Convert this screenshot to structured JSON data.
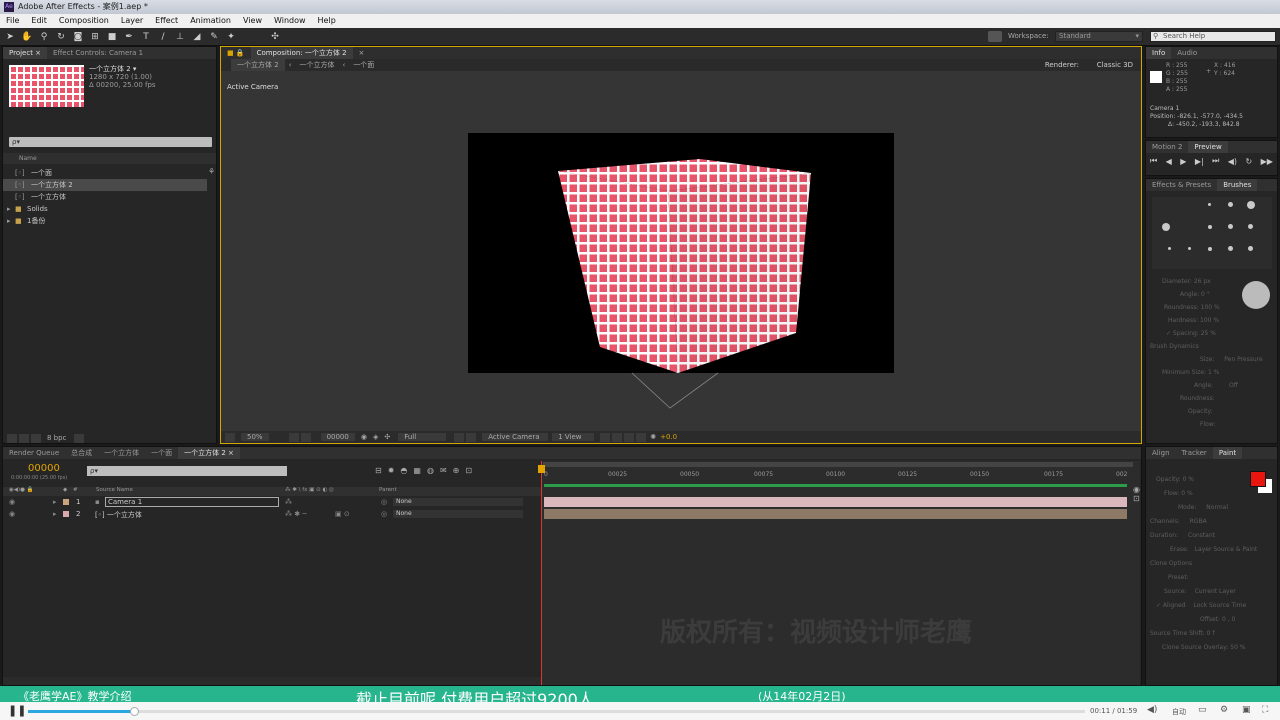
{
  "window": {
    "title": "Adobe After Effects - 案例1.aep *",
    "app_icon": "Ae"
  },
  "menu": [
    "File",
    "Edit",
    "Composition",
    "Layer",
    "Effect",
    "Animation",
    "View",
    "Window",
    "Help"
  ],
  "workspace": {
    "label": "Workspace:",
    "value": "Standard"
  },
  "search_help": {
    "placeholder": "Search Help"
  },
  "project_panel": {
    "tabs": [
      "Project ×",
      "Effect Controls: Camera 1"
    ],
    "item_name": "一个立方体 2 ▾",
    "item_dims": "1280 x 720 (1.00)",
    "item_duration": "Δ 00200, 25.00 fps",
    "search_placeholder": "ρ▾",
    "column_name": "Name",
    "items": [
      {
        "label": "一个面",
        "type": "comp"
      },
      {
        "label": "一个立方体 2",
        "type": "comp",
        "selected": true
      },
      {
        "label": "一个立方体",
        "type": "comp"
      },
      {
        "label": "Solids",
        "type": "folder"
      },
      {
        "label": "1备份",
        "type": "folder"
      }
    ],
    "bpc": "8 bpc"
  },
  "comp_panel": {
    "tab": "Composition: 一个立方体 2",
    "breadcrumbs": [
      "一个立方体 2",
      "一个立方体",
      "一个面"
    ],
    "renderer_label": "Renderer:",
    "renderer_value": "Classic 3D",
    "view_label": "Active Camera",
    "footer": {
      "zoom": "50%",
      "timecode": "00000",
      "resolution": "Full",
      "camera": "Active Camera",
      "views": "1 View",
      "offset": "+0.0"
    }
  },
  "info_panel": {
    "tabs": [
      "Info",
      "Audio"
    ],
    "r": "R : 255",
    "g": "G : 255",
    "b": "B : 255",
    "a": "A : 255",
    "x": "X : 416",
    "y": "Y : 624",
    "layer": "Camera 1",
    "position": "Position: -826.1, -577.0, -434.5",
    "delta": "Δ: -450.2, -193.3, 842.8"
  },
  "preview_panel": {
    "tabs": [
      "Motion 2",
      "Preview"
    ]
  },
  "brushes_panel": {
    "tabs": [
      "Effects & Presets",
      "Brushes"
    ],
    "diameter": "Diameter: 26 px",
    "angle": "Angle: 0 °",
    "roundness": "Roundness: 100 %",
    "hardness": "Hardness: 100 %",
    "spacing": "✓ Spacing: 25 %",
    "dynamics": "Brush Dynamics",
    "size": "Size:",
    "size_v": "Pen Pressure",
    "min_size": "Minimum Size: 1 %",
    "angle2": "Angle:",
    "off": "Off",
    "roundness2": "Roundness:",
    "opacity": "Opacity:",
    "flow": "Flow:"
  },
  "paint_panel": {
    "tabs": [
      "Align",
      "Tracker",
      "Paint"
    ],
    "opacity": "Opacity: 0 %",
    "flow": "Flow: 0 %",
    "mode": "Mode:",
    "mode_v": "Normal",
    "channels": "Channels:",
    "channels_v": "RGBA",
    "duration": "Duration:",
    "duration_v": "Constant",
    "erase": "Erase:",
    "erase_v": "Layer Source & Paint",
    "clone_options": "Clone Options",
    "preset": "Preset:",
    "source": "Source:",
    "source_v": "Current Layer",
    "aligned": "✓ Aligned",
    "lock_source": "Lock Source Time",
    "offset": "Offset: 0 , 0",
    "source_time": "Source Time Shift: 0 f",
    "clone_overlay": "Clone Source Overlay: 50 %",
    "fg_color": "#e8160f",
    "bg_color": "#ffffff"
  },
  "timeline": {
    "tabs": [
      "Render Queue",
      "总合成",
      "一个立方体",
      "一个面",
      "一个立方体 2 ×"
    ],
    "timecode": "00000",
    "timecode_sub": "0:00:00:00 (25.00 fps)",
    "search_placeholder": "ρ▾",
    "columns": {
      "source_name": "Source Name",
      "parent": "Parent"
    },
    "layers": [
      {
        "num": "1",
        "name": "Camera 1",
        "parent": "None",
        "color": "#c9a37a"
      },
      {
        "num": "2",
        "name": "[◦] 一个立方体",
        "parent": "None",
        "color": "#d9a9b0"
      }
    ],
    "ruler": [
      "0",
      "00025",
      "00050",
      "00075",
      "00100",
      "00125",
      "00150",
      "00175",
      "002"
    ]
  },
  "watermark": "版权所有：视频设计师老鹰",
  "banner": {
    "left": "《老鹰学AE》教学介绍",
    "main": "截止目前呢 付费用户超过9200人",
    "right": "(从14年02月2日)"
  },
  "player": {
    "time": "00:11 / 01:59",
    "quality": "自动",
    "progress": 0.1
  }
}
